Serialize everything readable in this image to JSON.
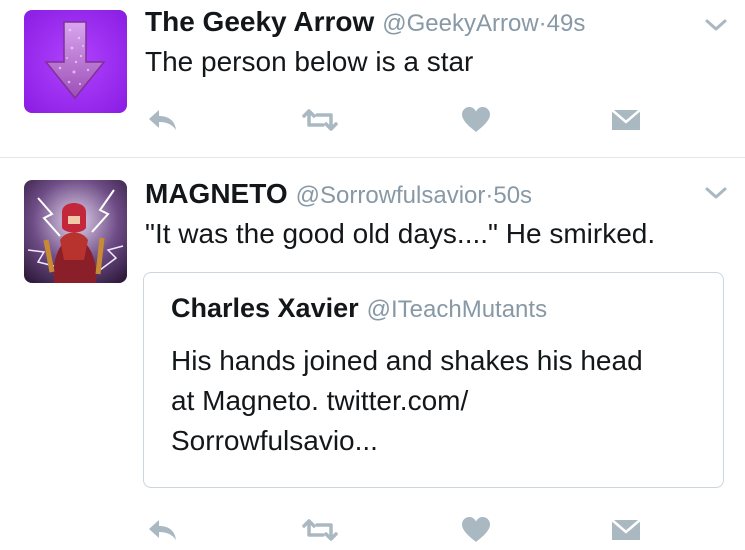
{
  "colors": {
    "secondary_text": "#8899a6",
    "icon": "#aab8c2",
    "divider": "#e1e8ed"
  },
  "timeline": [
    {
      "name": "The Geeky Arrow",
      "handle": "@GeekyArrow",
      "separator": "·",
      "time": "49s",
      "text": "The person below is a star",
      "avatar_icon": "purple-arrow-avatar"
    },
    {
      "name": "MAGNETO",
      "handle": "@Sorrowfulsavior",
      "separator": "·",
      "time": "50s",
      "text": "\"It was the good old days....\" He smirked.",
      "avatar_icon": "magneto-avatar",
      "quoted": {
        "name": "Charles Xavier",
        "handle": "@ITeachMutants",
        "lines": [
          "His hands joined and shakes his head",
          "at Magneto. twitter.com/",
          "Sorrowfulsavio..."
        ]
      }
    }
  ],
  "icons": {
    "reply": "reply-icon",
    "retweet": "retweet-icon",
    "like": "heart-icon",
    "message": "direct-message-icon",
    "menu": "chevron-down-icon"
  }
}
